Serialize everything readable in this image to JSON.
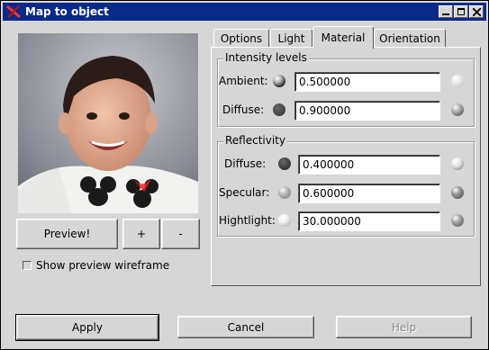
{
  "window": {
    "title": "Map to object"
  },
  "preview": {
    "button_label": "Preview!",
    "zoom_in_label": "+",
    "zoom_out_label": "-",
    "wireframe_label": "Show preview wireframe"
  },
  "tabs": [
    {
      "label": "Options"
    },
    {
      "label": "Light"
    },
    {
      "label": "Material",
      "active": true
    },
    {
      "label": "Orientation"
    }
  ],
  "intensity": {
    "title": "Intensity levels",
    "ambient_label": "Ambient:",
    "ambient_value": "0.500000",
    "diffuse_label": "Diffuse:",
    "diffuse_value": "0.900000"
  },
  "reflectivity": {
    "title": "Reflectivity",
    "diffuse_label": "Diffuse:",
    "diffuse_value": "0.400000",
    "specular_label": "Specular:",
    "specular_value": "0.600000",
    "highlight_label": "Hightlight:",
    "highlight_value": "30.000000"
  },
  "buttons": {
    "apply": "Apply",
    "cancel": "Cancel",
    "help": "Help"
  },
  "colors": {
    "titlebar": "#0a2a8a",
    "window_bg": "#d6d6d6"
  }
}
